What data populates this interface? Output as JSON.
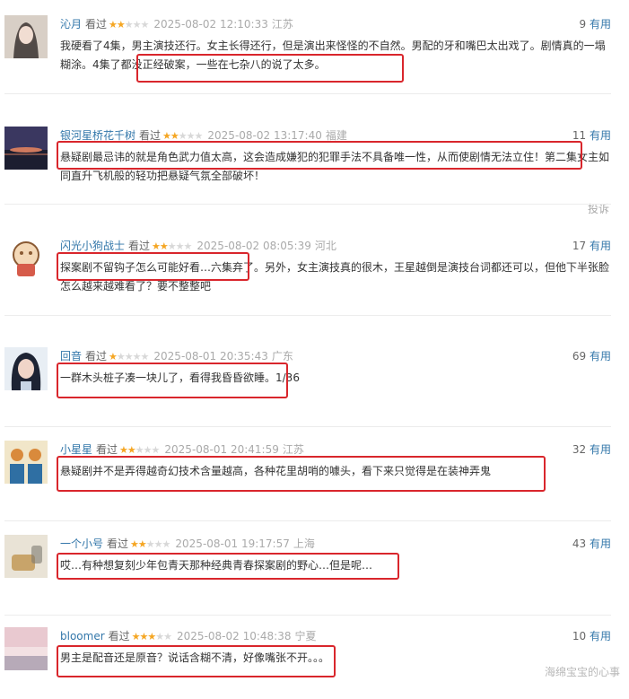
{
  "reviews": [
    {
      "user": "沁月",
      "action": "看过",
      "rating": 2,
      "time": "2025-08-02 12:10:33",
      "location": "江苏",
      "useful_count": "9",
      "useful_label": "有用",
      "content": "我硬看了4集，男主演技还行。女主长得还行，但是演出来怪怪的不自然。男配的牙和嘴巴太出戏了。剧情真的一塌糊涂。4集了都没正经破案，一些在七杂八的说了太多。",
      "avatar_colors": [
        "#d8cfc6",
        "#3a3330",
        "#f1ddd2"
      ]
    },
    {
      "user": "银河星桥花千树",
      "action": "看过",
      "rating": 2,
      "time": "2025-08-02 13:17:40",
      "location": "福建",
      "useful_count": "11",
      "useful_label": "有用",
      "content": "悬疑剧最忌讳的就是角色武力值太高，这会造成嫌犯的犯罪手法不具备唯一性，从而使剧情无法立住！第二集女主如同直升飞机般的轻功把悬疑气氛全部破坏！",
      "report": "投诉",
      "avatar_colors": [
        "#3a3760",
        "#d07a5e",
        "#1c1e30"
      ]
    },
    {
      "user": "闪光小狗战士",
      "action": "看过",
      "rating": 2,
      "time": "2025-08-02 08:05:39",
      "location": "河北",
      "useful_count": "17",
      "useful_label": "有用",
      "content": "探案剧不留钩子怎么可能好看…六集弃了。另外，女主演技真的很木，王星越倒是演技台词都还可以，但他下半张脸怎么越来越难看了？要不整整吧",
      "avatar_colors": [
        "#f4d9b8",
        "#8a5a33",
        "#d65b4a"
      ]
    },
    {
      "user": "回音",
      "action": "看过",
      "rating": 1,
      "time": "2025-08-01 20:35:43",
      "location": "广东",
      "useful_count": "69",
      "useful_label": "有用",
      "content": "一群木头桩子凑一块儿了，看得我昏昏欲睡。1/36",
      "avatar_colors": [
        "#e8eef4",
        "#1d2333",
        "#f0d5c8"
      ]
    },
    {
      "user": "小星星",
      "action": "看过",
      "rating": 2,
      "time": "2025-08-01 20:41:59",
      "location": "江苏",
      "useful_count": "32",
      "useful_label": "有用",
      "content": "悬疑剧并不是弄得越奇幻技术含量越高，各种花里胡哨的噱头，看下来只觉得是在装神弄鬼",
      "avatar_colors": [
        "#f1e6c9",
        "#2f6fa3",
        "#d98a3c"
      ]
    },
    {
      "user": "一个小号",
      "action": "看过",
      "rating": 2,
      "time": "2025-08-01 19:17:57",
      "location": "上海",
      "useful_count": "43",
      "useful_label": "有用",
      "content": "哎…有种想复刻少年包青天那种经典青春探案剧的野心…但是呢…",
      "avatar_colors": [
        "#e9e3d6",
        "#c8a46a",
        "#7d7a70"
      ]
    },
    {
      "user": "bloomer",
      "action": "看过",
      "rating": 3,
      "time": "2025-08-02 10:48:38",
      "location": "宁夏",
      "useful_count": "10",
      "useful_label": "有用",
      "content": "男主是配音还是原音？说话含糊不清，好像嘴张不开。。。",
      "avatar_colors": [
        "#e9c9d0",
        "#b7aab8",
        "#f3e1e3"
      ]
    }
  ],
  "watermark": "海绵宝宝的心事"
}
